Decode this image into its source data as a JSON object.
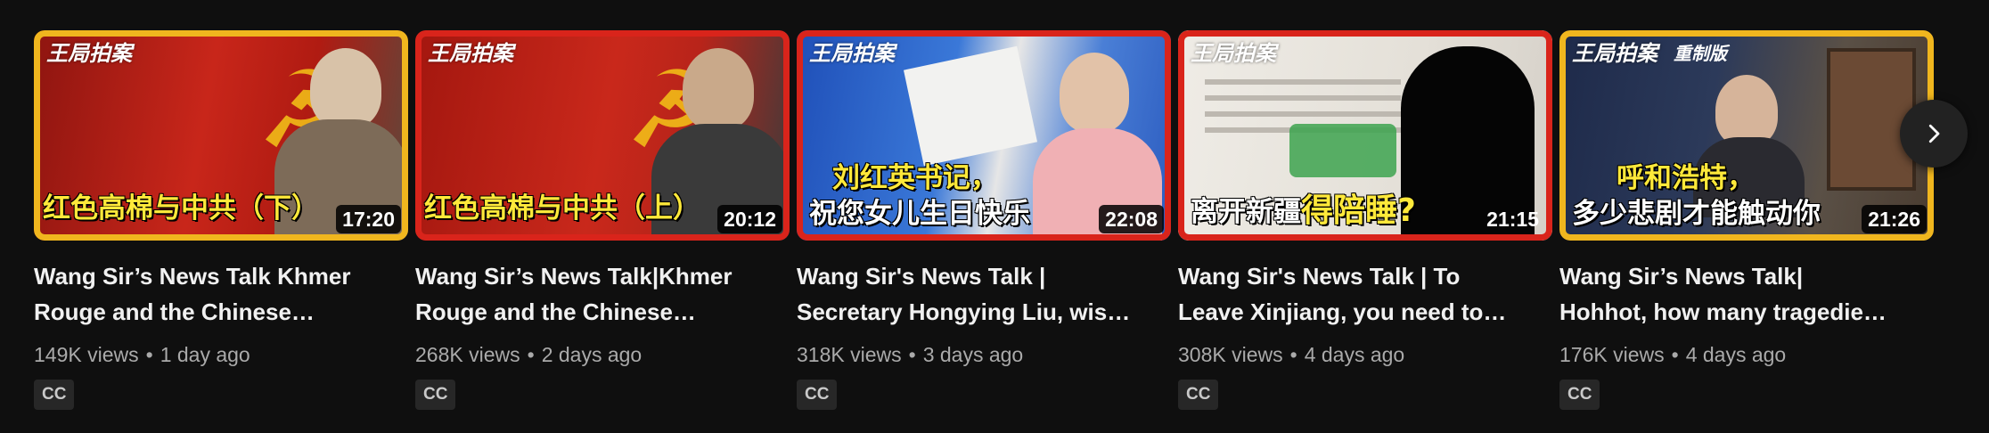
{
  "videos": [
    {
      "brand": "王局拍案",
      "caption": "红色高棉与中共（下）",
      "duration": "17:20",
      "title_line1": "Wang Sir’s News Talk Khmer",
      "title_line2": "Rouge and the Chinese…",
      "views": "149K views",
      "age": "1 day ago",
      "badge": "CC"
    },
    {
      "brand": "王局拍案",
      "caption": "红色高棉与中共（上）",
      "duration": "20:12",
      "title_line1": "Wang Sir’s News Talk|Khmer",
      "title_line2": "Rouge and the Chinese…",
      "views": "268K views",
      "age": "2 days ago",
      "badge": "CC"
    },
    {
      "brand": "王局拍案",
      "caption_line1": "刘红英书记，",
      "caption_line2": "祝您女儿生日快乐",
      "duration": "22:08",
      "title_line1": "Wang Sir's News Talk |",
      "title_line2": "Secretary Hongying Liu, wis…",
      "views": "318K views",
      "age": "3 days ago",
      "badge": "CC"
    },
    {
      "brand": "王局拍案",
      "caption_a": "离开新疆",
      "caption_b": "得陪睡?",
      "duration": "21:15",
      "title_line1": "Wang Sir's News Talk | To",
      "title_line2": "Leave Xinjiang, you need to…",
      "views": "308K views",
      "age": "4 days ago",
      "badge": "CC"
    },
    {
      "brand": "王局拍案",
      "brand2": "重制版",
      "caption_line1": "呼和浩特，",
      "caption_line2": "多少悲剧才能触动你",
      "duration": "21:26",
      "title_line1": "Wang Sir’s News Talk|",
      "title_line2": "Hohhot, how many tragedie…",
      "views": "176K views",
      "age": "4 days ago",
      "badge": "CC"
    }
  ],
  "separator": "•",
  "icons": {
    "next": "chevron-right-icon"
  },
  "colors": {
    "background": "#0f0f0f",
    "frame_red": "#d9241b",
    "frame_yellow": "#f0b61e",
    "caption_yellow": "#ffe93a"
  }
}
